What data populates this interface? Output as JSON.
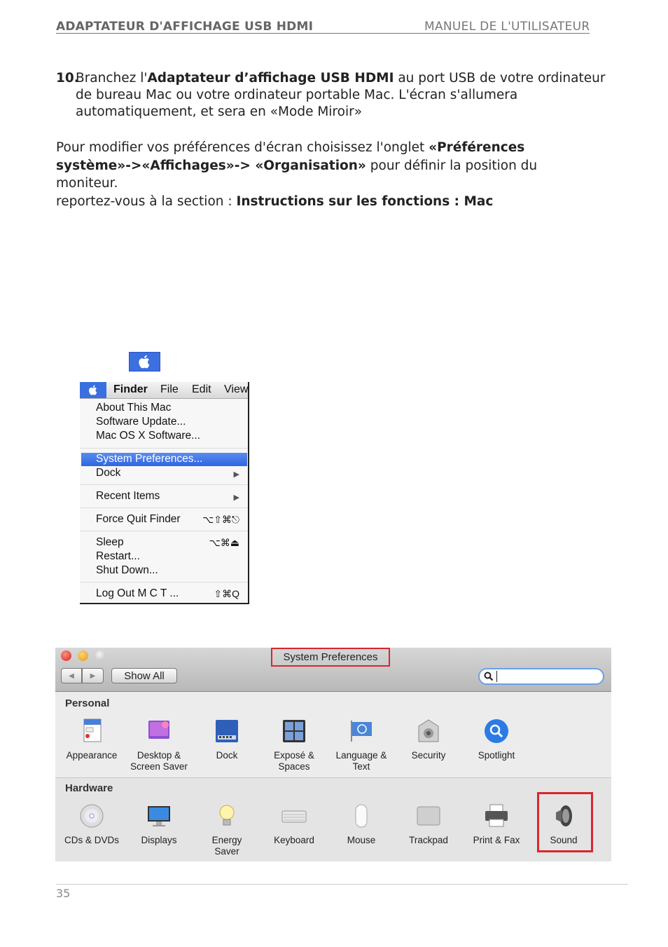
{
  "header": {
    "left": "ADAPTATEUR D'AFFICHAGE USB HDMI",
    "right": "MANUEL DE L'UTILISATEUR"
  },
  "step": {
    "number": "10.",
    "pre": "Branchez l'",
    "bold": "Adaptateur d’affichage USB HDMI",
    "post": " au port USB de votre ordinateur de bureau Mac ou votre ordinateur portable Mac. L'écran s'allumera automatiquement, et sera en «Mode Miroir»"
  },
  "paragraph": {
    "t1": "Pour modifier vos préférences d'écran choisissez l'onglet ",
    "b1": "«Préférences système»->«Affichages»-> «Organisation»",
    "t2": " pour définir la position du moniteur.",
    "t3": "reportez-vous à la section : ",
    "b2": "Instructions sur les fonctions : Mac"
  },
  "finder_menu": {
    "menubar": [
      "Finder",
      "File",
      "Edit",
      "View"
    ],
    "items": {
      "about": "About This Mac",
      "update": "Software Update...",
      "software": "Mac OS X Software...",
      "sysprefs": "System Preferences...",
      "dock": "Dock",
      "recent": "Recent Items",
      "forcequit": "Force Quit Finder",
      "forcequit_shortcut": "⌥⇧⌘⎋",
      "sleep": "Sleep",
      "sleep_shortcut": "⌥⌘⏏",
      "restart": "Restart...",
      "shutdown": "Shut Down...",
      "logout": "Log Out M C T ...",
      "logout_shortcut": "⇧⌘Q"
    }
  },
  "system_preferences": {
    "title": "System Preferences",
    "show_all": "Show All",
    "search_value": "",
    "personal_title": "Personal",
    "hardware_title": "Hardware",
    "personal": [
      {
        "l1": "Appearance",
        "l2": "",
        "icon": "appearance-icon"
      },
      {
        "l1": "Desktop &",
        "l2": "Screen Saver",
        "icon": "desktop-icon"
      },
      {
        "l1": "Dock",
        "l2": "",
        "icon": "dock-icon"
      },
      {
        "l1": "Exposé &",
        "l2": "Spaces",
        "icon": "expose-icon"
      },
      {
        "l1": "Language &",
        "l2": "Text",
        "icon": "language-icon"
      },
      {
        "l1": "Security",
        "l2": "",
        "icon": "security-icon"
      },
      {
        "l1": "Spotlight",
        "l2": "",
        "icon": "spotlight-icon"
      }
    ],
    "hardware": [
      {
        "l1": "CDs & DVDs",
        "l2": "",
        "icon": "cd-icon"
      },
      {
        "l1": "Displays",
        "l2": "",
        "icon": "display-icon"
      },
      {
        "l1": "Energy",
        "l2": "Saver",
        "icon": "energy-icon"
      },
      {
        "l1": "Keyboard",
        "l2": "",
        "icon": "keyboard-icon"
      },
      {
        "l1": "Mouse",
        "l2": "",
        "icon": "mouse-icon"
      },
      {
        "l1": "Trackpad",
        "l2": "",
        "icon": "trackpad-icon"
      },
      {
        "l1": "Print & Fax",
        "l2": "",
        "icon": "printer-icon"
      },
      {
        "l1": "Sound",
        "l2": "",
        "icon": "sound-icon"
      }
    ]
  },
  "footer": {
    "page": "35"
  }
}
